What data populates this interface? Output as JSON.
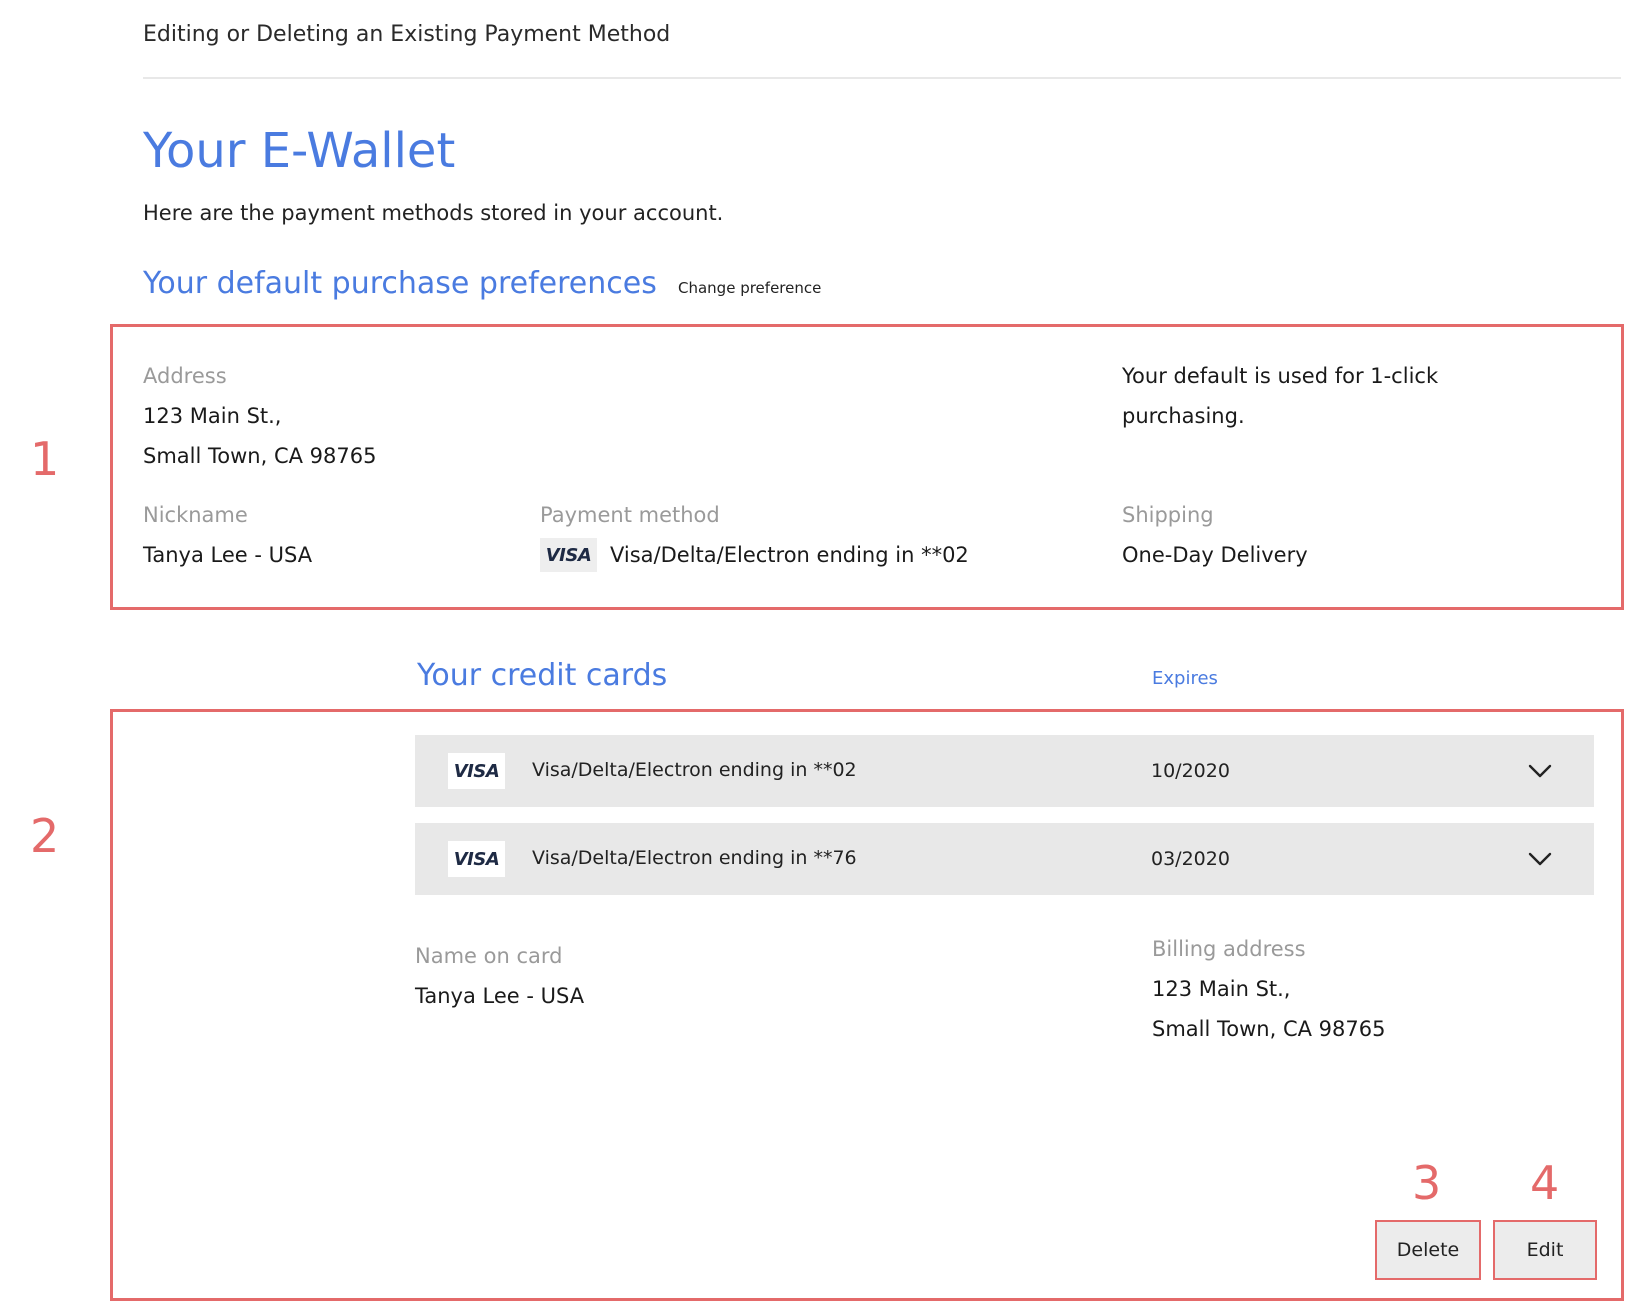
{
  "document": {
    "title": "Editing or Deleting an Existing Payment Method"
  },
  "page": {
    "heading": "Your E-Wallet",
    "intro": "Here are the payment methods stored in your account."
  },
  "preferences": {
    "heading": "Your default purchase preferences",
    "change_link": "Change preference",
    "address_label": "Address",
    "address_line1": "123 Main St.,",
    "address_line2": "Small Town, CA  98765",
    "default_note_line1": "Your default is used for 1-click",
    "default_note_line2": "purchasing.",
    "nickname_label": "Nickname",
    "nickname_value": "Tanya Lee - USA",
    "payment_label": "Payment method",
    "payment_brand": "VISA",
    "payment_value": "Visa/Delta/Electron ending in **02",
    "shipping_label": "Shipping",
    "shipping_value": "One-Day Delivery"
  },
  "credit_cards": {
    "heading": "Your credit cards",
    "expires_label": "Expires",
    "cards": [
      {
        "brand": "VISA",
        "description": "Visa/Delta/Electron ending in **02",
        "expires": "10/2020"
      },
      {
        "brand": "VISA",
        "description": "Visa/Delta/Electron ending in **76",
        "expires": "03/2020"
      }
    ],
    "details": {
      "name_label": "Name on card",
      "name_value": "Tanya Lee - USA",
      "billing_label": "Billing address",
      "billing_line1": "123 Main St.,",
      "billing_line2": "Small Town, CA  98765"
    },
    "delete_label": "Delete",
    "edit_label": "Edit"
  },
  "annotations": {
    "n1": "1",
    "n2": "2",
    "n3": "3",
    "n4": "4",
    "color": "#e46a6a"
  },
  "colors": {
    "accent": "#4a7be0",
    "row_background": "#e8e8e8"
  }
}
